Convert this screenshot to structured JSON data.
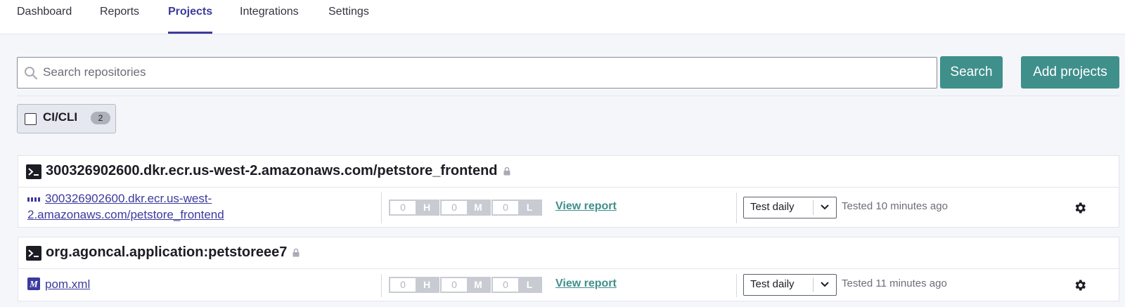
{
  "nav": {
    "items": [
      {
        "label": "Dashboard",
        "active": false
      },
      {
        "label": "Reports",
        "active": false
      },
      {
        "label": "Projects",
        "active": true
      },
      {
        "label": "Integrations",
        "active": false
      },
      {
        "label": "Settings",
        "active": false
      }
    ]
  },
  "search": {
    "placeholder": "Search repositories",
    "value": "",
    "button_label": "Search"
  },
  "add_projects_label": "Add projects",
  "filters": [
    {
      "label": "CI/CLI",
      "count": "2",
      "checked": false
    }
  ],
  "projects": [
    {
      "title": "300326902600.dkr.ecr.us-west-2.amazonaws.com/petstore_frontend",
      "private": true,
      "target": {
        "icon": "container-image-icon",
        "link_lines": [
          "300326902600.dkr.ecr.us-west-",
          "2.amazonaws.com/petstore_frontend"
        ]
      },
      "issues": [
        {
          "count": "0",
          "letter": "H"
        },
        {
          "count": "0",
          "letter": "M"
        },
        {
          "count": "0",
          "letter": "L"
        }
      ],
      "view_report": "View report",
      "frequency": "Test daily",
      "tested": "Tested 10 minutes ago"
    },
    {
      "title": "org.agoncal.application:petstoreee7",
      "private": true,
      "target": {
        "icon": "maven-icon",
        "link_lines": [
          "pom.xml"
        ]
      },
      "issues": [
        {
          "count": "0",
          "letter": "H"
        },
        {
          "count": "0",
          "letter": "M"
        },
        {
          "count": "0",
          "letter": "L"
        }
      ],
      "view_report": "View report",
      "frequency": "Test daily",
      "tested": "Tested 11 minutes ago"
    }
  ],
  "colors": {
    "accent": "#3c3a9e",
    "teal": "#3f8f8b",
    "severity_gray": "#c9cbd3"
  }
}
